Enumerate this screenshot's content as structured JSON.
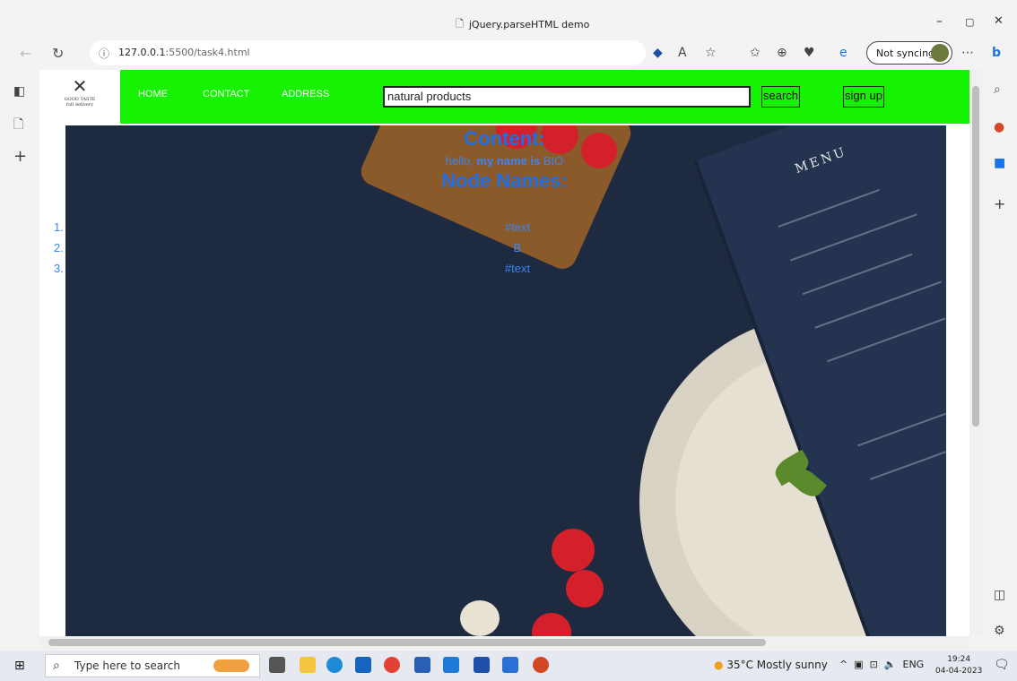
{
  "browser": {
    "window_title": "jQuery.parseHTML demo",
    "url_host": "127.0.0.1",
    "url_rest": ":5500/task4.html",
    "sync_label": "Not syncing",
    "controls": {
      "minimize": "–",
      "restore": "▢",
      "close": "✕"
    }
  },
  "site": {
    "logo_text": "GOOD TASTE",
    "logo_sub": "full delivery",
    "nav": [
      "HOME",
      "CONTACT",
      "ADDRESS"
    ],
    "search_value": "natural products",
    "search_button": "search",
    "signup_button": "sign up",
    "header_color": "#16f202"
  },
  "content": {
    "heading": "Content:",
    "text_before": "hello, ",
    "text_bold": "my name is",
    "text_after": " BIO",
    "node_heading": "Node Names:",
    "nodes": [
      {
        "num": "1.",
        "name": "#text"
      },
      {
        "num": "2.",
        "name": "B"
      },
      {
        "num": "3.",
        "name": "#text"
      }
    ]
  },
  "hero": {
    "menu_title": "MENU"
  },
  "taskbar": {
    "search_placeholder": "Type here to search",
    "weather": "35°C  Mostly sunny",
    "lang": "ENG",
    "time": "19:24",
    "date": "04-04-2023"
  }
}
